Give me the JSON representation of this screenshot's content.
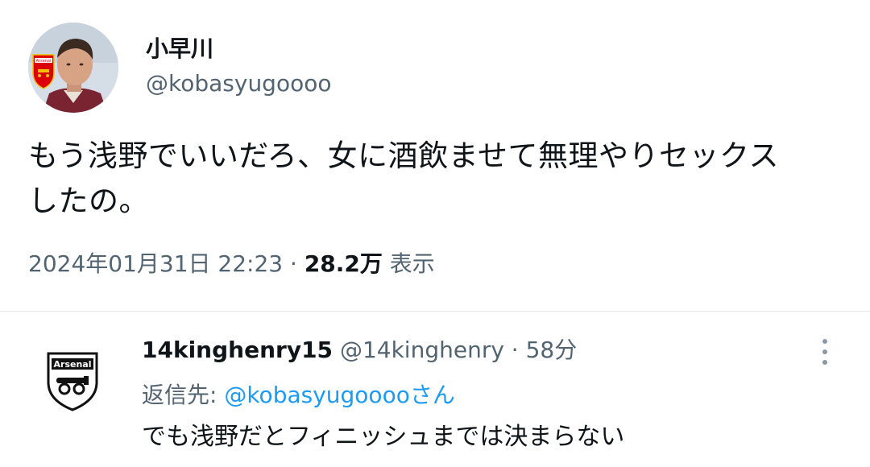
{
  "tweet": {
    "display_name": "小早川",
    "handle": "@kobasyugoooo",
    "text_line1": "もう浅野でいいだろ、女に酒飲ませて無理やりセックス",
    "text_line2": "したの。",
    "timestamp": "2024年01月31日 22:23",
    "separator": " · ",
    "views_count": "28.2万",
    "views_label": " 表示",
    "avatar_icon": "profile-photo-icon",
    "badge_text": "Arsenal"
  },
  "reply": {
    "display_name": "14kinghenry15",
    "handle": "@14kinghenry",
    "separator": " · ",
    "time": "58分",
    "reply_prefix": "返信先: ",
    "reply_mention": "@kobasyugoooo",
    "reply_suffix": "さん",
    "text": "でも浅野だとフィニッシュまでは決まらない",
    "avatar_text": "Arsenal",
    "more_icon": "more-options-icon"
  },
  "colors": {
    "text": "#0f1419",
    "secondary": "#536471",
    "link": "#1d9bf0",
    "divider": "#e6e9ec"
  }
}
